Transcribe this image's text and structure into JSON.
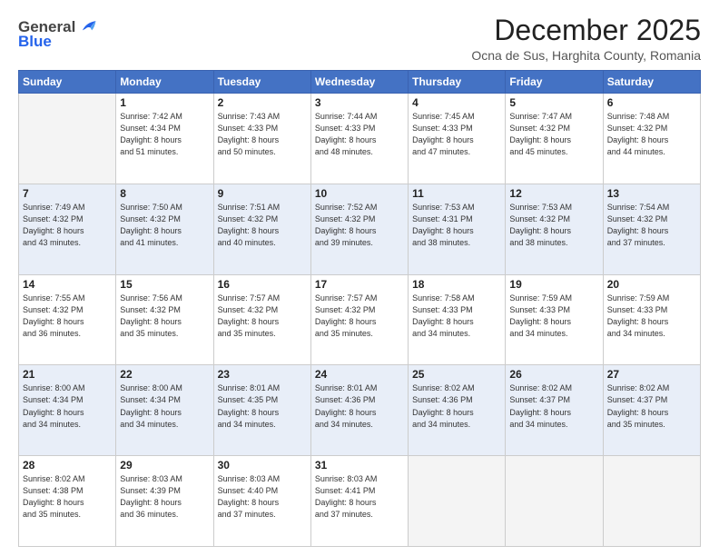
{
  "header": {
    "logo_line1": "General",
    "logo_line2": "Blue",
    "month_title": "December 2025",
    "subtitle": "Ocna de Sus, Harghita County, Romania"
  },
  "days_of_week": [
    "Sunday",
    "Monday",
    "Tuesday",
    "Wednesday",
    "Thursday",
    "Friday",
    "Saturday"
  ],
  "weeks": [
    [
      {
        "day": "",
        "info": ""
      },
      {
        "day": "1",
        "info": "Sunrise: 7:42 AM\nSunset: 4:34 PM\nDaylight: 8 hours\nand 51 minutes."
      },
      {
        "day": "2",
        "info": "Sunrise: 7:43 AM\nSunset: 4:33 PM\nDaylight: 8 hours\nand 50 minutes."
      },
      {
        "day": "3",
        "info": "Sunrise: 7:44 AM\nSunset: 4:33 PM\nDaylight: 8 hours\nand 48 minutes."
      },
      {
        "day": "4",
        "info": "Sunrise: 7:45 AM\nSunset: 4:33 PM\nDaylight: 8 hours\nand 47 minutes."
      },
      {
        "day": "5",
        "info": "Sunrise: 7:47 AM\nSunset: 4:32 PM\nDaylight: 8 hours\nand 45 minutes."
      },
      {
        "day": "6",
        "info": "Sunrise: 7:48 AM\nSunset: 4:32 PM\nDaylight: 8 hours\nand 44 minutes."
      }
    ],
    [
      {
        "day": "7",
        "info": "Sunrise: 7:49 AM\nSunset: 4:32 PM\nDaylight: 8 hours\nand 43 minutes."
      },
      {
        "day": "8",
        "info": "Sunrise: 7:50 AM\nSunset: 4:32 PM\nDaylight: 8 hours\nand 41 minutes."
      },
      {
        "day": "9",
        "info": "Sunrise: 7:51 AM\nSunset: 4:32 PM\nDaylight: 8 hours\nand 40 minutes."
      },
      {
        "day": "10",
        "info": "Sunrise: 7:52 AM\nSunset: 4:32 PM\nDaylight: 8 hours\nand 39 minutes."
      },
      {
        "day": "11",
        "info": "Sunrise: 7:53 AM\nSunset: 4:31 PM\nDaylight: 8 hours\nand 38 minutes."
      },
      {
        "day": "12",
        "info": "Sunrise: 7:53 AM\nSunset: 4:32 PM\nDaylight: 8 hours\nand 38 minutes."
      },
      {
        "day": "13",
        "info": "Sunrise: 7:54 AM\nSunset: 4:32 PM\nDaylight: 8 hours\nand 37 minutes."
      }
    ],
    [
      {
        "day": "14",
        "info": "Sunrise: 7:55 AM\nSunset: 4:32 PM\nDaylight: 8 hours\nand 36 minutes."
      },
      {
        "day": "15",
        "info": "Sunrise: 7:56 AM\nSunset: 4:32 PM\nDaylight: 8 hours\nand 35 minutes."
      },
      {
        "day": "16",
        "info": "Sunrise: 7:57 AM\nSunset: 4:32 PM\nDaylight: 8 hours\nand 35 minutes."
      },
      {
        "day": "17",
        "info": "Sunrise: 7:57 AM\nSunset: 4:32 PM\nDaylight: 8 hours\nand 35 minutes."
      },
      {
        "day": "18",
        "info": "Sunrise: 7:58 AM\nSunset: 4:33 PM\nDaylight: 8 hours\nand 34 minutes."
      },
      {
        "day": "19",
        "info": "Sunrise: 7:59 AM\nSunset: 4:33 PM\nDaylight: 8 hours\nand 34 minutes."
      },
      {
        "day": "20",
        "info": "Sunrise: 7:59 AM\nSunset: 4:33 PM\nDaylight: 8 hours\nand 34 minutes."
      }
    ],
    [
      {
        "day": "21",
        "info": "Sunrise: 8:00 AM\nSunset: 4:34 PM\nDaylight: 8 hours\nand 34 minutes."
      },
      {
        "day": "22",
        "info": "Sunrise: 8:00 AM\nSunset: 4:34 PM\nDaylight: 8 hours\nand 34 minutes."
      },
      {
        "day": "23",
        "info": "Sunrise: 8:01 AM\nSunset: 4:35 PM\nDaylight: 8 hours\nand 34 minutes."
      },
      {
        "day": "24",
        "info": "Sunrise: 8:01 AM\nSunset: 4:36 PM\nDaylight: 8 hours\nand 34 minutes."
      },
      {
        "day": "25",
        "info": "Sunrise: 8:02 AM\nSunset: 4:36 PM\nDaylight: 8 hours\nand 34 minutes."
      },
      {
        "day": "26",
        "info": "Sunrise: 8:02 AM\nSunset: 4:37 PM\nDaylight: 8 hours\nand 34 minutes."
      },
      {
        "day": "27",
        "info": "Sunrise: 8:02 AM\nSunset: 4:37 PM\nDaylight: 8 hours\nand 35 minutes."
      }
    ],
    [
      {
        "day": "28",
        "info": "Sunrise: 8:02 AM\nSunset: 4:38 PM\nDaylight: 8 hours\nand 35 minutes."
      },
      {
        "day": "29",
        "info": "Sunrise: 8:03 AM\nSunset: 4:39 PM\nDaylight: 8 hours\nand 36 minutes."
      },
      {
        "day": "30",
        "info": "Sunrise: 8:03 AM\nSunset: 4:40 PM\nDaylight: 8 hours\nand 37 minutes."
      },
      {
        "day": "31",
        "info": "Sunrise: 8:03 AM\nSunset: 4:41 PM\nDaylight: 8 hours\nand 37 minutes."
      },
      {
        "day": "",
        "info": ""
      },
      {
        "day": "",
        "info": ""
      },
      {
        "day": "",
        "info": ""
      }
    ]
  ]
}
